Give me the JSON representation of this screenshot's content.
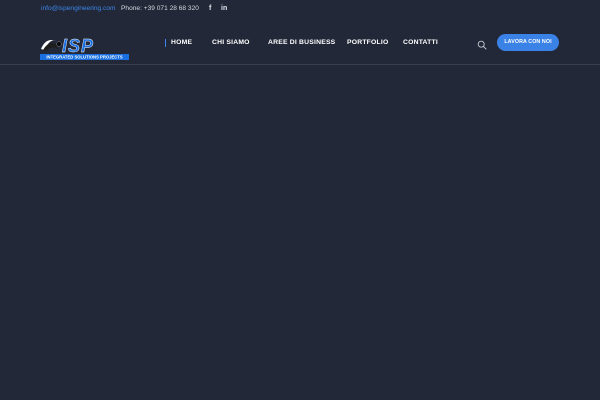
{
  "topbar": {
    "email": "info@ispengineering.com",
    "phone": "Phone: +39 071 28 68 320",
    "social": [
      {
        "name": "facebook-icon",
        "glyph": "f"
      },
      {
        "name": "linkedin-icon",
        "glyph": "in"
      }
    ]
  },
  "logo": {
    "mark": "ISP",
    "tagline": "INTEGRATED SOLUTIONS PROJECTS"
  },
  "nav": {
    "items": [
      "HOME",
      "CHI SIAMO",
      "AREE DI BUSINESS",
      "PORTFOLIO",
      "CONTATTI"
    ],
    "active_index": 0
  },
  "header": {
    "search_icon": "search-icon",
    "cta_label": "Lavora con noi"
  },
  "colors": {
    "background": "#232838",
    "accent": "#3b82e6",
    "text": "#ffffff"
  }
}
